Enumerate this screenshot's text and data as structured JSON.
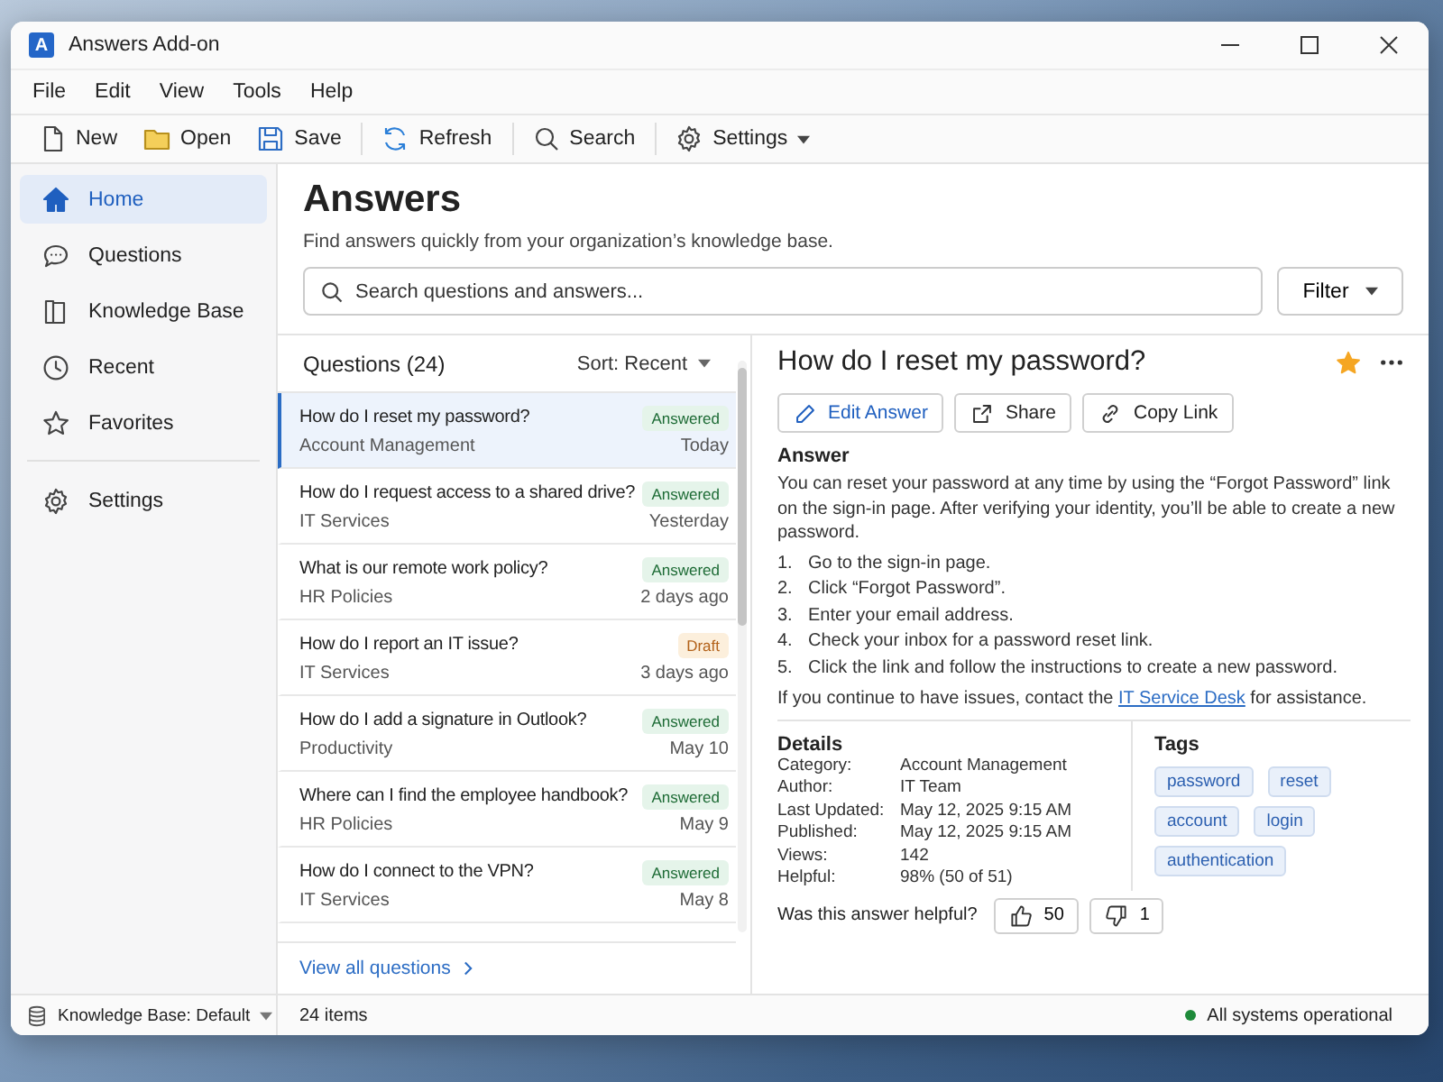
{
  "window": {
    "logo_letter": "A",
    "title": "Answers Add-on"
  },
  "menu": [
    "File",
    "Edit",
    "View",
    "Tools",
    "Help"
  ],
  "toolbar": {
    "groups": [
      [
        {
          "label": "New"
        },
        {
          "label": "Open"
        },
        {
          "label": "Save"
        }
      ],
      [
        {
          "label": "Refresh"
        }
      ],
      [
        {
          "label": "Search"
        }
      ],
      [
        {
          "label": "Settings",
          "dropdown": true
        }
      ]
    ]
  },
  "sidebar": {
    "items": [
      {
        "label": "Home",
        "selected": true
      },
      {
        "label": "Questions",
        "selected": false
      },
      {
        "label": "Knowledge Base",
        "selected": false
      },
      {
        "label": "Recent",
        "selected": false
      },
      {
        "label": "Favorites",
        "selected": false
      }
    ],
    "bottom_items": [
      {
        "label": "Settings",
        "selected": false
      }
    ]
  },
  "header": {
    "title": "Answers",
    "subtitle": "Find answers quickly from your organization’s knowledge base.",
    "search": {
      "placeholder": "Search questions and answers..."
    },
    "filter_button": "Filter"
  },
  "questions": {
    "title": "Questions (24)",
    "sort": "Sort: Recent",
    "rows": [
      {
        "question": "How do I reset my password?",
        "category": "Account Management",
        "status": "Answered",
        "kind": "answered",
        "date": "Today",
        "selected": true
      },
      {
        "question": "How do I request access to a shared drive?",
        "category": "IT Services",
        "status": "Answered",
        "kind": "answered",
        "date": "Yesterday",
        "selected": false
      },
      {
        "question": "What is our remote work policy?",
        "category": "HR Policies",
        "status": "Answered",
        "kind": "answered",
        "date": "2 days ago",
        "selected": false
      },
      {
        "question": "How do I report an IT issue?",
        "category": "IT Services",
        "status": "Draft",
        "kind": "draft",
        "date": "3 days ago",
        "selected": false
      },
      {
        "question": "How do I add a signature in Outlook?",
        "category": "Productivity",
        "status": "Answered",
        "kind": "answered",
        "date": "May 10",
        "selected": false
      },
      {
        "question": "Where can I find the employee handbook?",
        "category": "HR Policies",
        "status": "Answered",
        "kind": "answered",
        "date": "May 9",
        "selected": false
      },
      {
        "question": "How do I connect to the VPN?",
        "category": "IT Services",
        "status": "Answered",
        "kind": "answered",
        "date": "May 8",
        "selected": false
      }
    ],
    "view_all": "View all questions"
  },
  "detail": {
    "title": "How do I reset my password?",
    "favorite": true,
    "actions": [
      {
        "label": "Edit Answer",
        "kind": "primary"
      },
      {
        "label": "Share",
        "kind": "share"
      },
      {
        "label": "Copy Link",
        "kind": "link"
      }
    ],
    "answer_heading": "Answer",
    "answer_text": "You can reset your password at any time by using the “Forgot Password” link on the sign-in page. After verifying your identity, you’ll be able to create a new password.",
    "steps": [
      {
        "number": "1.",
        "text": "Go to the sign-in page."
      },
      {
        "number": "2.",
        "text": "Click “Forgot Password”."
      },
      {
        "number": "3.",
        "text": "Enter your email address."
      },
      {
        "number": "4.",
        "text": "Check your inbox for a password reset link."
      },
      {
        "number": "5.",
        "text": "Click the link and follow the instructions to create a new password."
      }
    ],
    "closing": {
      "before": "If you continue to have issues, contact the ",
      "link": "IT Service Desk",
      "after": " for assistance."
    },
    "details_heading": "Details",
    "details": [
      {
        "label": "Category:",
        "value": "Account Management"
      },
      {
        "label": "Author:",
        "value": "IT Team"
      },
      {
        "label": "Last Updated:",
        "value": "May 12, 2025 9:15 AM"
      },
      {
        "label": "Published:",
        "value": "May 12, 2025 9:15 AM"
      },
      {
        "label": "Views:",
        "value": "142"
      },
      {
        "label": "Helpful:",
        "value": "98% (50 of 51)"
      }
    ],
    "tags_heading": "Tags",
    "tags": [
      "password",
      "reset",
      "account",
      "login",
      "authentication"
    ],
    "feedback": {
      "question": "Was this answer helpful?",
      "up": "50",
      "down": "1"
    }
  },
  "status_bar": {
    "knowledge_base": "Knowledge Base: Default",
    "items": "24 items",
    "system": "All systems operational"
  }
}
